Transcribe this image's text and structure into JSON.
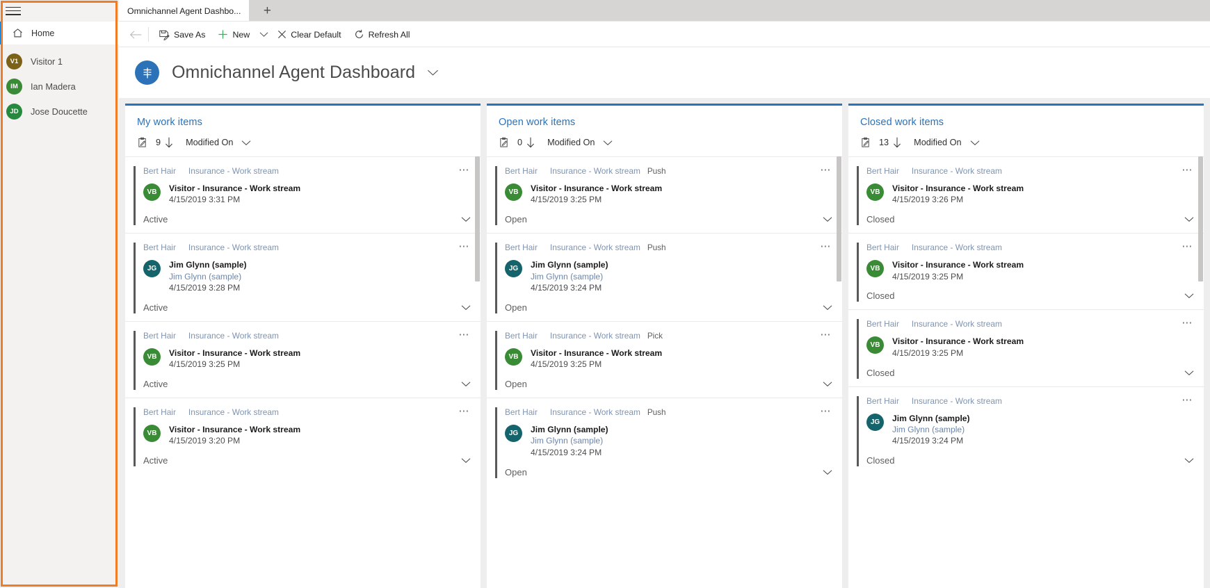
{
  "sidebar": {
    "hamburger_label": "Site map",
    "home": {
      "label": "Home",
      "icon": "home-icon"
    },
    "people": [
      {
        "initials": "V1",
        "name": "Visitor 1",
        "color": "#7b6216"
      },
      {
        "initials": "IM",
        "name": "Ian Madera",
        "color": "#3a8b35"
      },
      {
        "initials": "JD",
        "name": "Jose Doucette",
        "color": "#258a3d"
      }
    ]
  },
  "tabstrip": {
    "active_tab": "Omnichannel Agent Dashbo...",
    "new_tab_label": "+"
  },
  "commandbar": {
    "back_label": "Back",
    "save_as": "Save As",
    "new": "New",
    "clear_default": "Clear Default",
    "refresh_all": "Refresh All"
  },
  "pagehead": {
    "title": "Omnichannel Agent Dashboard",
    "icon": "dashboard-icon",
    "accent": "#2b72b8"
  },
  "columns": [
    {
      "title": "My work items",
      "count": "9",
      "sort_field": "Modified On",
      "cards": [
        {
          "owner": "Bert Hair",
          "stream": "Insurance - Work stream",
          "tag": "",
          "initials": "VB",
          "avatar_color": "#3a8b35",
          "title": "Visitor - Insurance - Work stream",
          "sub": "",
          "time": "4/15/2019 3:31 PM",
          "status": "Active"
        },
        {
          "owner": "Bert Hair",
          "stream": "Insurance - Work stream",
          "tag": "",
          "initials": "JG",
          "avatar_color": "#15636b",
          "title": "Jim Glynn (sample)",
          "sub": "Jim Glynn (sample)",
          "time": "4/15/2019 3:28 PM",
          "status": "Active"
        },
        {
          "owner": "Bert Hair",
          "stream": "Insurance - Work stream",
          "tag": "",
          "initials": "VB",
          "avatar_color": "#3a8b35",
          "title": "Visitor - Insurance - Work stream",
          "sub": "",
          "time": "4/15/2019 3:25 PM",
          "status": "Active"
        },
        {
          "owner": "Bert Hair",
          "stream": "Insurance - Work stream",
          "tag": "",
          "initials": "VB",
          "avatar_color": "#3a8b35",
          "title": "Visitor - Insurance - Work stream",
          "sub": "",
          "time": "4/15/2019 3:20 PM",
          "status": "Active"
        }
      ]
    },
    {
      "title": "Open work items",
      "count": "0",
      "sort_field": "Modified On",
      "cards": [
        {
          "owner": "Bert Hair",
          "stream": "Insurance - Work stream",
          "tag": "Push",
          "initials": "VB",
          "avatar_color": "#3a8b35",
          "title": "Visitor - Insurance - Work stream",
          "sub": "",
          "time": "4/15/2019 3:25 PM",
          "status": "Open"
        },
        {
          "owner": "Bert Hair",
          "stream": "Insurance - Work stream",
          "tag": "Push",
          "initials": "JG",
          "avatar_color": "#15636b",
          "title": "Jim Glynn (sample)",
          "sub": "Jim Glynn (sample)",
          "time": "4/15/2019 3:24 PM",
          "status": "Open"
        },
        {
          "owner": "Bert Hair",
          "stream": "Insurance - Work stream",
          "tag": "Pick",
          "initials": "VB",
          "avatar_color": "#3a8b35",
          "title": "Visitor - Insurance - Work stream",
          "sub": "",
          "time": "4/15/2019 3:25 PM",
          "status": "Open"
        },
        {
          "owner": "Bert Hair",
          "stream": "Insurance - Work stream",
          "tag": "Push",
          "initials": "JG",
          "avatar_color": "#15636b",
          "title": "Jim Glynn (sample)",
          "sub": "Jim Glynn (sample)",
          "time": "4/15/2019 3:24 PM",
          "status": "Open"
        }
      ]
    },
    {
      "title": "Closed work items",
      "count": "13",
      "sort_field": "Modified On",
      "cards": [
        {
          "owner": "Bert Hair",
          "stream": "Insurance - Work stream",
          "tag": "",
          "initials": "VB",
          "avatar_color": "#3a8b35",
          "title": "Visitor - Insurance - Work stream",
          "sub": "",
          "time": "4/15/2019 3:26 PM",
          "status": "Closed"
        },
        {
          "owner": "Bert Hair",
          "stream": "Insurance - Work stream",
          "tag": "",
          "initials": "VB",
          "avatar_color": "#3a8b35",
          "title": "Visitor - Insurance - Work stream",
          "sub": "",
          "time": "4/15/2019 3:25 PM",
          "status": "Closed"
        },
        {
          "owner": "Bert Hair",
          "stream": "Insurance - Work stream",
          "tag": "",
          "initials": "VB",
          "avatar_color": "#3a8b35",
          "title": "Visitor - Insurance - Work stream",
          "sub": "",
          "time": "4/15/2019 3:25 PM",
          "status": "Closed"
        },
        {
          "owner": "Bert Hair",
          "stream": "Insurance - Work stream",
          "tag": "",
          "initials": "JG",
          "avatar_color": "#15636b",
          "title": "Jim Glynn (sample)",
          "sub": "Jim Glynn (sample)",
          "time": "4/15/2019 3:24 PM",
          "status": "Closed"
        }
      ]
    }
  ],
  "icons": {
    "ellipsis": "…",
    "chevron_down": "chevron-down-icon",
    "arrow_down": "arrow-down-icon",
    "clipboard": "clipboard-icon"
  }
}
